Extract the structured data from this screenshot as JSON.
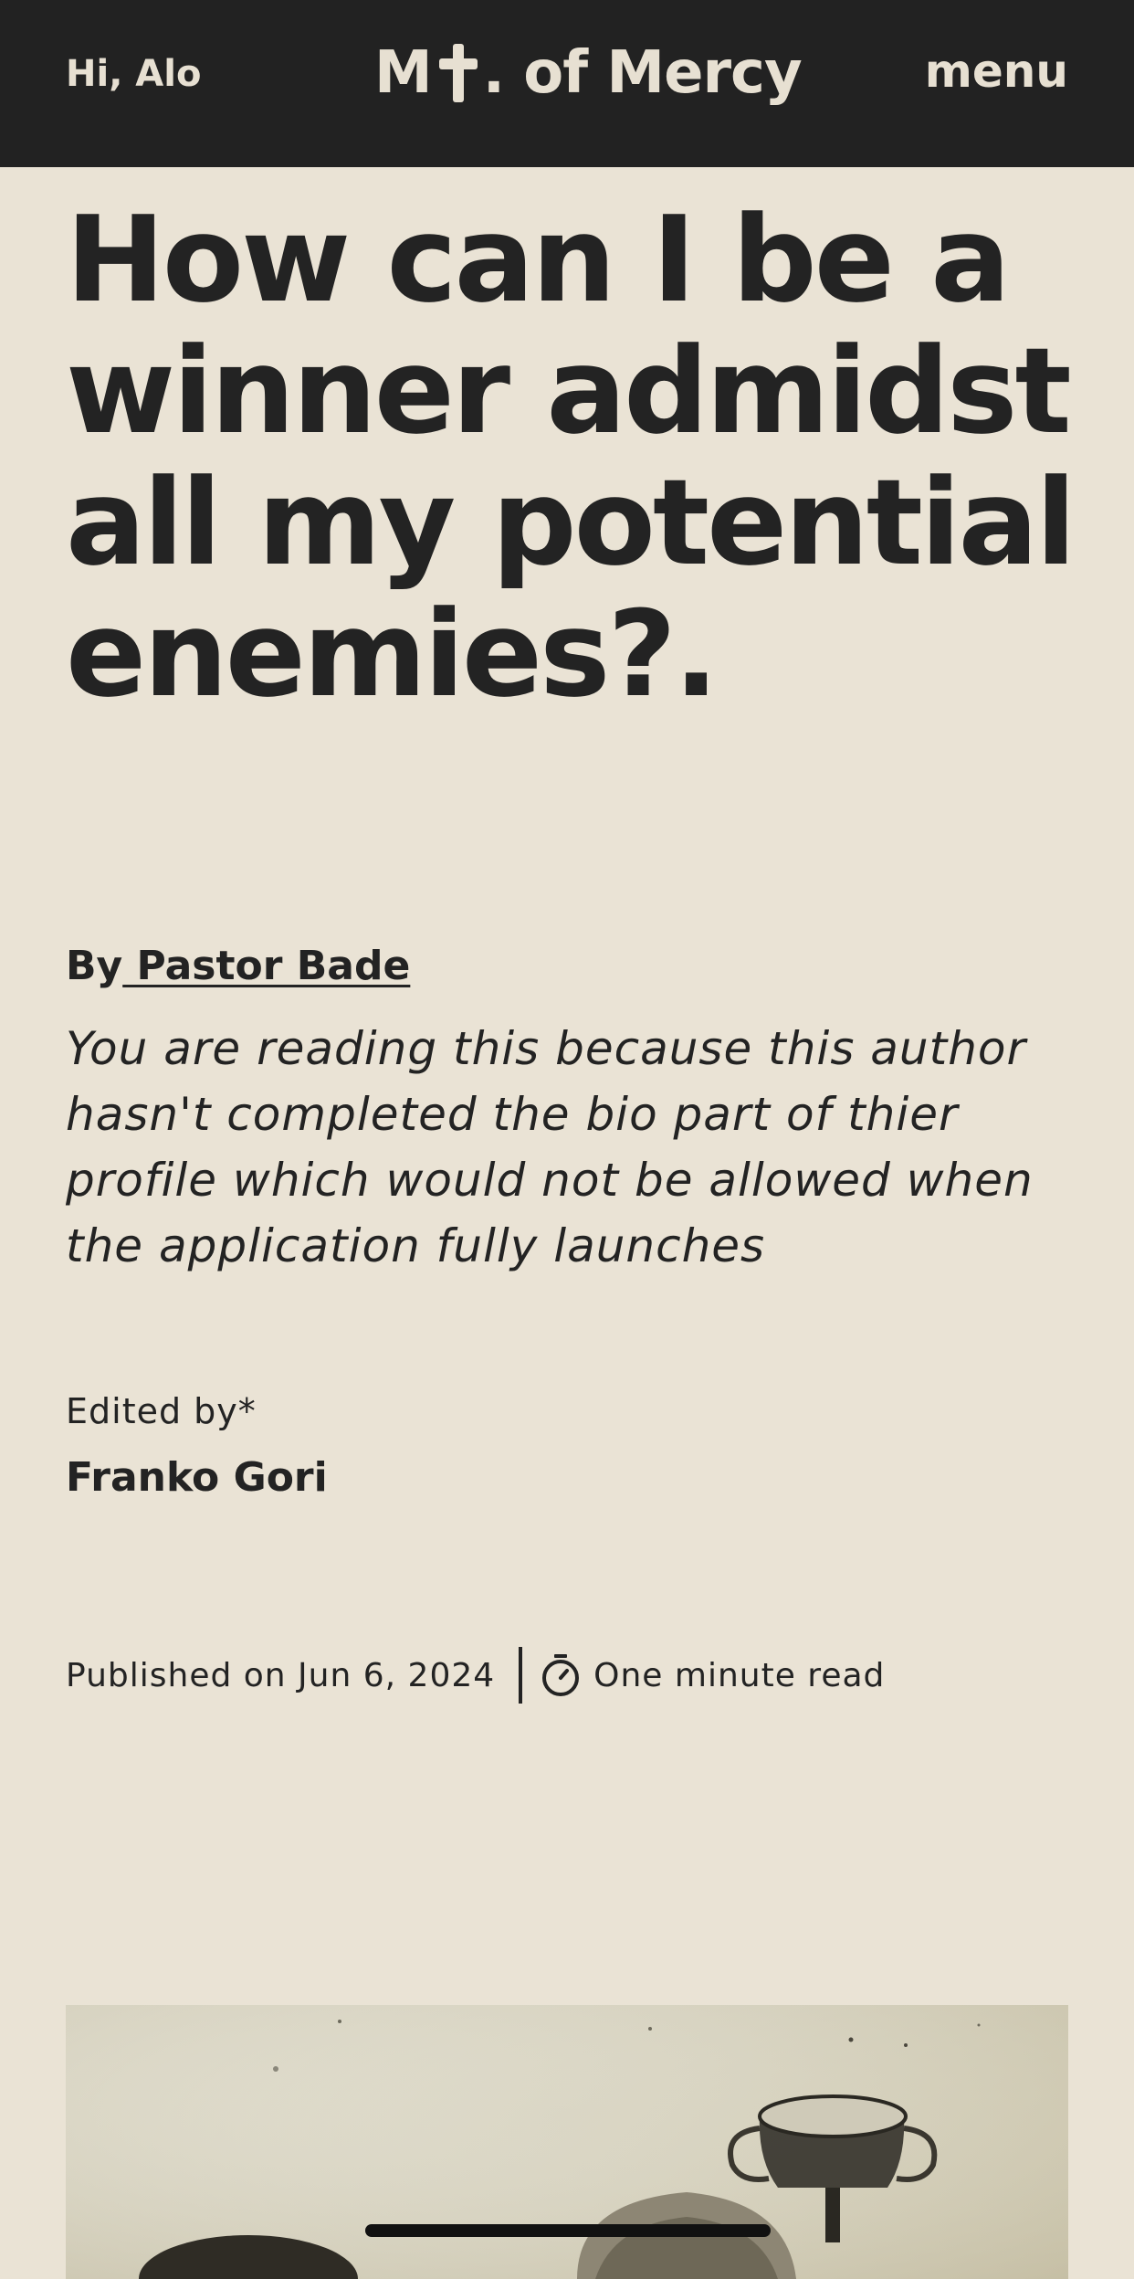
{
  "header": {
    "greeting": "Hi, Alo",
    "brand_prefix": "M",
    "brand_icon": "cross-icon",
    "brand_suffix": ". of Mercy",
    "menu_label": "menu"
  },
  "article": {
    "title": "How can I be a winner admidst all my potential enemies?.",
    "byline_prefix": "By",
    "author": " Pastor Bade",
    "author_bio": "You are reading this because this author hasn't completed the bio part of thier profile which would not be allowed when the application fully launches",
    "edited_by_label": "Edited by*",
    "editor": "Franko Gori",
    "published": "Published on Jun 6, 2024",
    "read_time_icon": "stopwatch-icon",
    "read_time": "One minute read"
  },
  "colors": {
    "background": "#eae3d5",
    "header_bg": "#222222",
    "header_text": "#e7e0d2",
    "text": "#232323"
  }
}
